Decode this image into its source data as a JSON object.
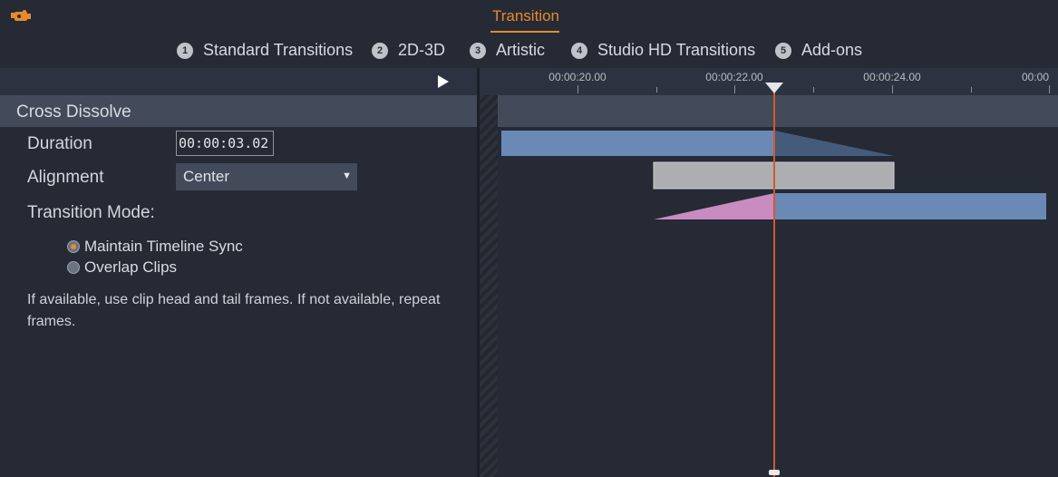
{
  "header": {
    "title": "Transition",
    "app_icon": "camera-icon",
    "accent_color": "#e9892c",
    "categories": [
      {
        "num": "1",
        "label": "Standard Transitions"
      },
      {
        "num": "2",
        "label": "2D-3D"
      },
      {
        "num": "3",
        "label": "Artistic"
      },
      {
        "num": "4",
        "label": "Studio HD Transitions"
      },
      {
        "num": "5",
        "label": "Add-ons"
      }
    ]
  },
  "panel": {
    "play_icon": "play-icon",
    "section_title": "Cross Dissolve",
    "duration_label": "Duration",
    "duration_value": "00:00:03.02",
    "alignment_label": "Alignment",
    "alignment_value": "Center",
    "mode_label": "Transition Mode:",
    "modes": [
      {
        "label": "Maintain Timeline Sync",
        "selected": true
      },
      {
        "label": "Overlap Clips",
        "selected": false
      }
    ],
    "description": "If available, use clip head and tail frames. If not available, repeat frames."
  },
  "timeline": {
    "tick_labels": [
      "00:00:20.00",
      "00:00:22.00",
      "00:00:24.00",
      "00:00"
    ],
    "playhead_color": "#d9542c",
    "clip_colors": {
      "outgoing": "#6a8ab5",
      "transition": "#acaeb2",
      "incoming": "#6a8ab5",
      "incoming_ramp": "#c88cc0"
    }
  }
}
